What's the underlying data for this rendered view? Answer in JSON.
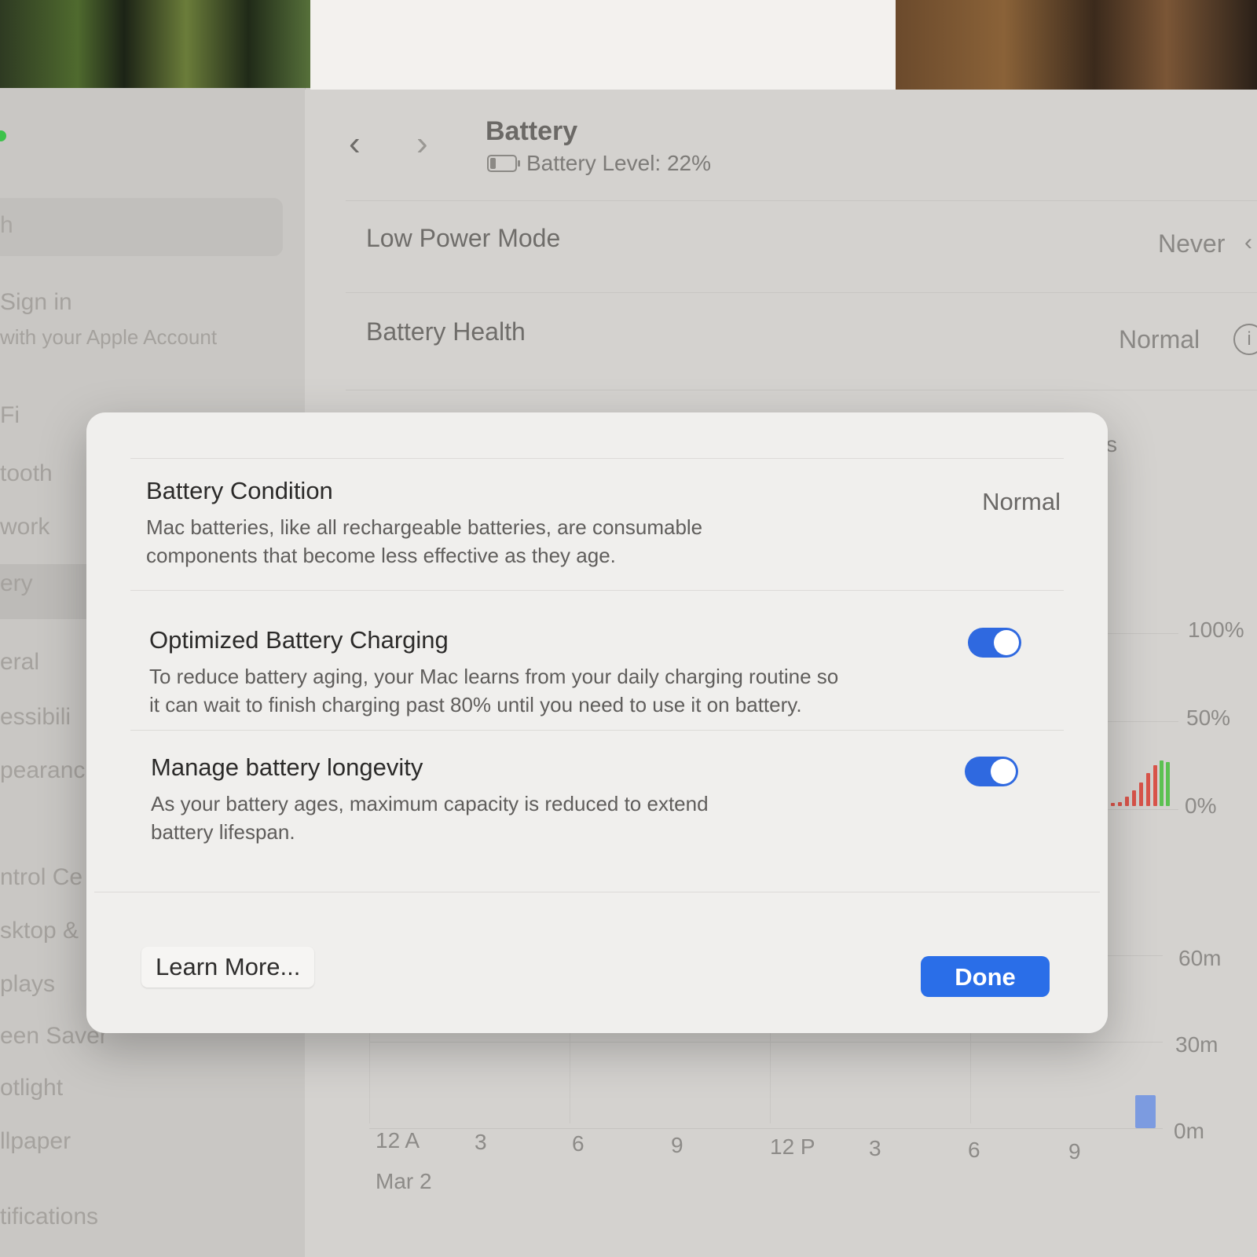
{
  "header": {
    "title": "Battery",
    "battery_level": "Battery Level: 22%",
    "nav_back": "‹",
    "nav_forward": "›"
  },
  "sidebar": {
    "search_placeholder": "h",
    "sign_in_title": "Sign in",
    "sign_in_subtitle": "with your Apple Account",
    "items": [
      {
        "label": "Fi"
      },
      {
        "label": "tooth"
      },
      {
        "label": "work"
      },
      {
        "label": "ery"
      },
      {
        "label": "eral"
      },
      {
        "label": "essibili"
      },
      {
        "label": "pearanc"
      },
      {
        "label": "ntrol Ce"
      },
      {
        "label": "sktop &"
      },
      {
        "label": "plays"
      },
      {
        "label": "een Saver"
      },
      {
        "label": "otlight"
      },
      {
        "label": "llpaper"
      },
      {
        "label": "tifications"
      }
    ]
  },
  "settings": {
    "low_power_label": "Low Power Mode",
    "low_power_value": "Never",
    "health_label": "Battery Health",
    "health_value": "Normal",
    "peek_letter": "s"
  },
  "background_chart": {
    "level_axis": [
      "100%",
      "50%",
      "0%"
    ],
    "usage_axis": [
      "60m",
      "30m",
      "0m"
    ],
    "x_ticks": [
      "12 A",
      "3",
      "6",
      "9",
      "12 P",
      "3",
      "6",
      "9"
    ],
    "date_label": "Mar 2",
    "colors": {
      "low": "#d9544a",
      "high": "#5cc152",
      "usage": "#7c9be0"
    }
  },
  "modal": {
    "condition_title": "Battery Condition",
    "condition_value": "Normal",
    "condition_desc_1": "Mac batteries, like all rechargeable batteries, are consumable",
    "condition_desc_2": "components that become less effective as they age.",
    "optimized_title": "Optimized Battery Charging",
    "optimized_desc_1": "To reduce battery aging, your Mac learns from your daily charging routine so",
    "optimized_desc_2": "it can wait to finish charging past 80% until you need to use it on battery.",
    "optimized_on": true,
    "longevity_title": "Manage battery longevity",
    "longevity_desc_1": "As your battery ages, maximum capacity is reduced to extend",
    "longevity_desc_2": "battery lifespan.",
    "longevity_on": true,
    "learn_more": "Learn More...",
    "done": "Done"
  },
  "colors": {
    "accent": "#2a6ee8",
    "toggle_on": "#2f69e0"
  }
}
